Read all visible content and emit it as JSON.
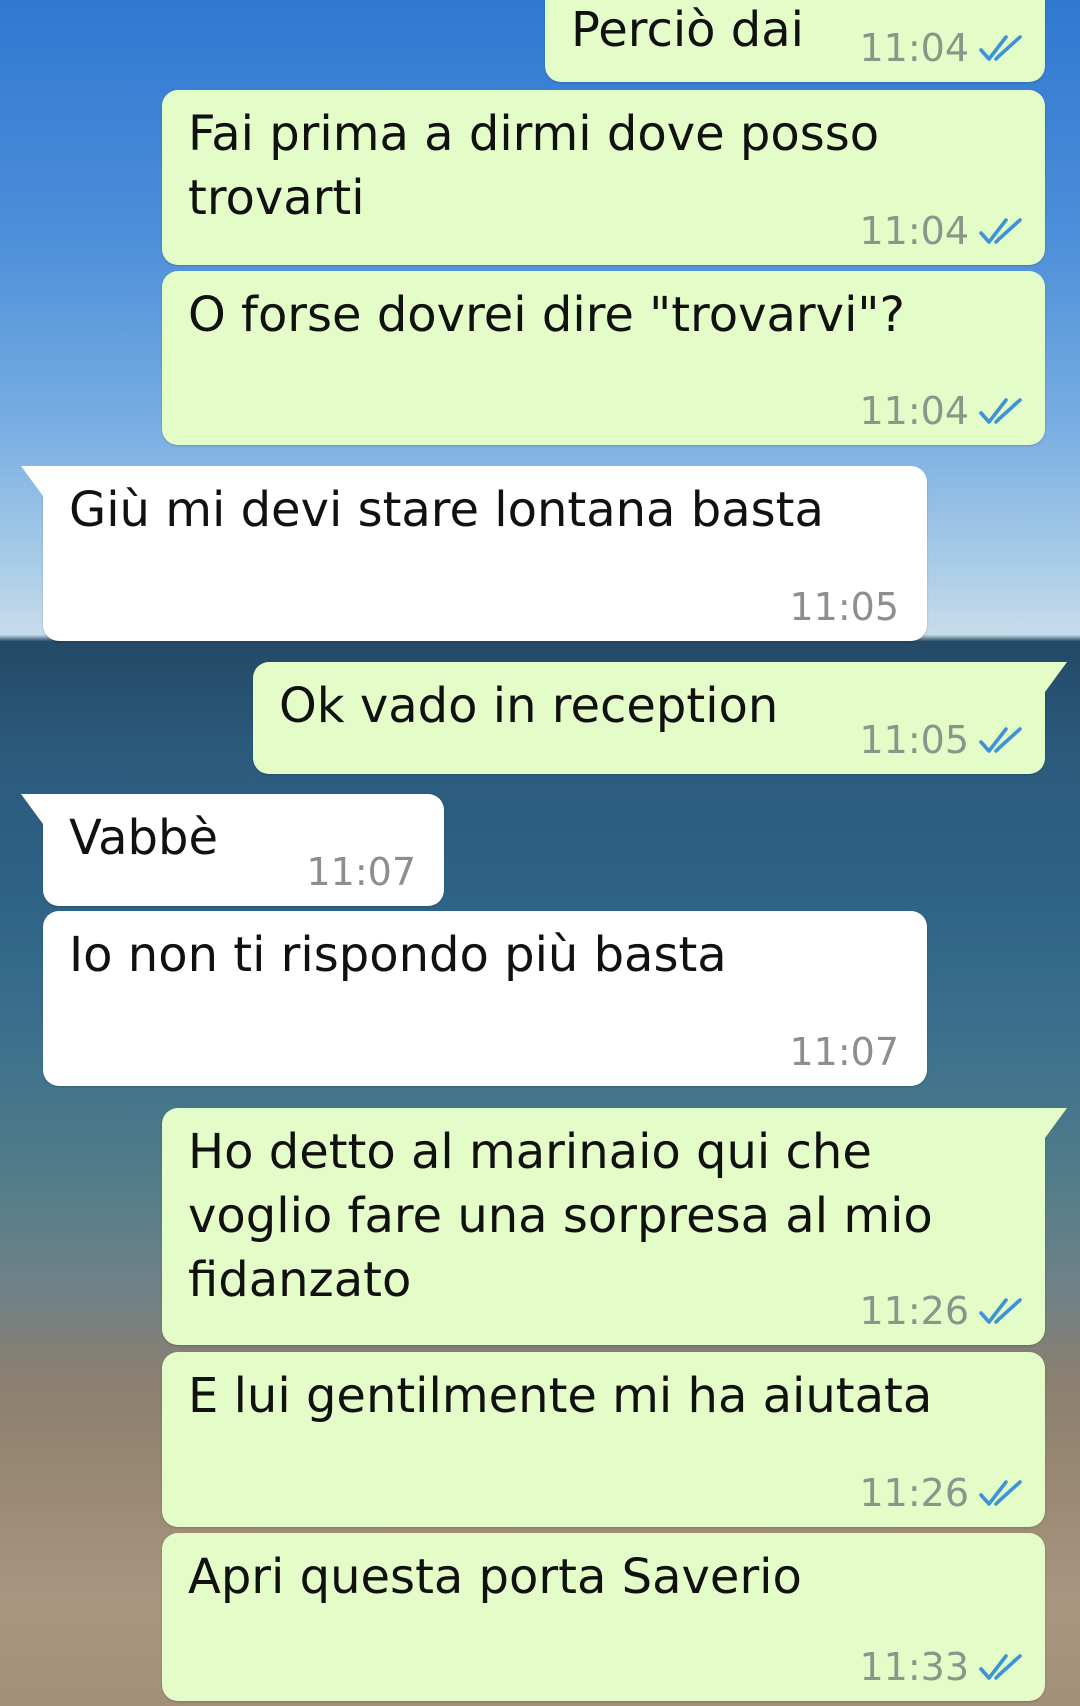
{
  "messages": [
    {
      "text": "Perciò dai",
      "time": "11:04",
      "direction": "out",
      "status": "read"
    },
    {
      "text": "Fai prima a dirmi dove posso\ntrovarti",
      "time": "11:04",
      "direction": "out",
      "status": "read"
    },
    {
      "text": "O forse dovrei dire \"trovarvi\"?",
      "time": "11:04",
      "direction": "out",
      "status": "read"
    },
    {
      "text": "Giù mi devi stare lontana basta",
      "time": "11:05",
      "direction": "in"
    },
    {
      "text": "Ok vado in reception",
      "time": "11:05",
      "direction": "out",
      "status": "read"
    },
    {
      "text": "Vabbè",
      "time": "11:07",
      "direction": "in"
    },
    {
      "text": "Io non ti rispondo più basta",
      "time": "11:07",
      "direction": "in"
    },
    {
      "text": "Ho detto al marinaio qui che\nvoglio fare una sorpresa al mio\nfidanzato",
      "time": "11:26",
      "direction": "out",
      "status": "read"
    },
    {
      "text": "E lui gentilmente mi ha aiutata",
      "time": "11:26",
      "direction": "out",
      "status": "read"
    },
    {
      "text": "Apri questa porta Saverio",
      "time": "11:33",
      "direction": "out",
      "status": "read"
    }
  ],
  "colors": {
    "outgoing_bubble": "#e4fcc8",
    "incoming_bubble": "#ffffff",
    "read_ticks": "#3d93d6"
  },
  "icons": {
    "read_status": "double-check-icon"
  }
}
